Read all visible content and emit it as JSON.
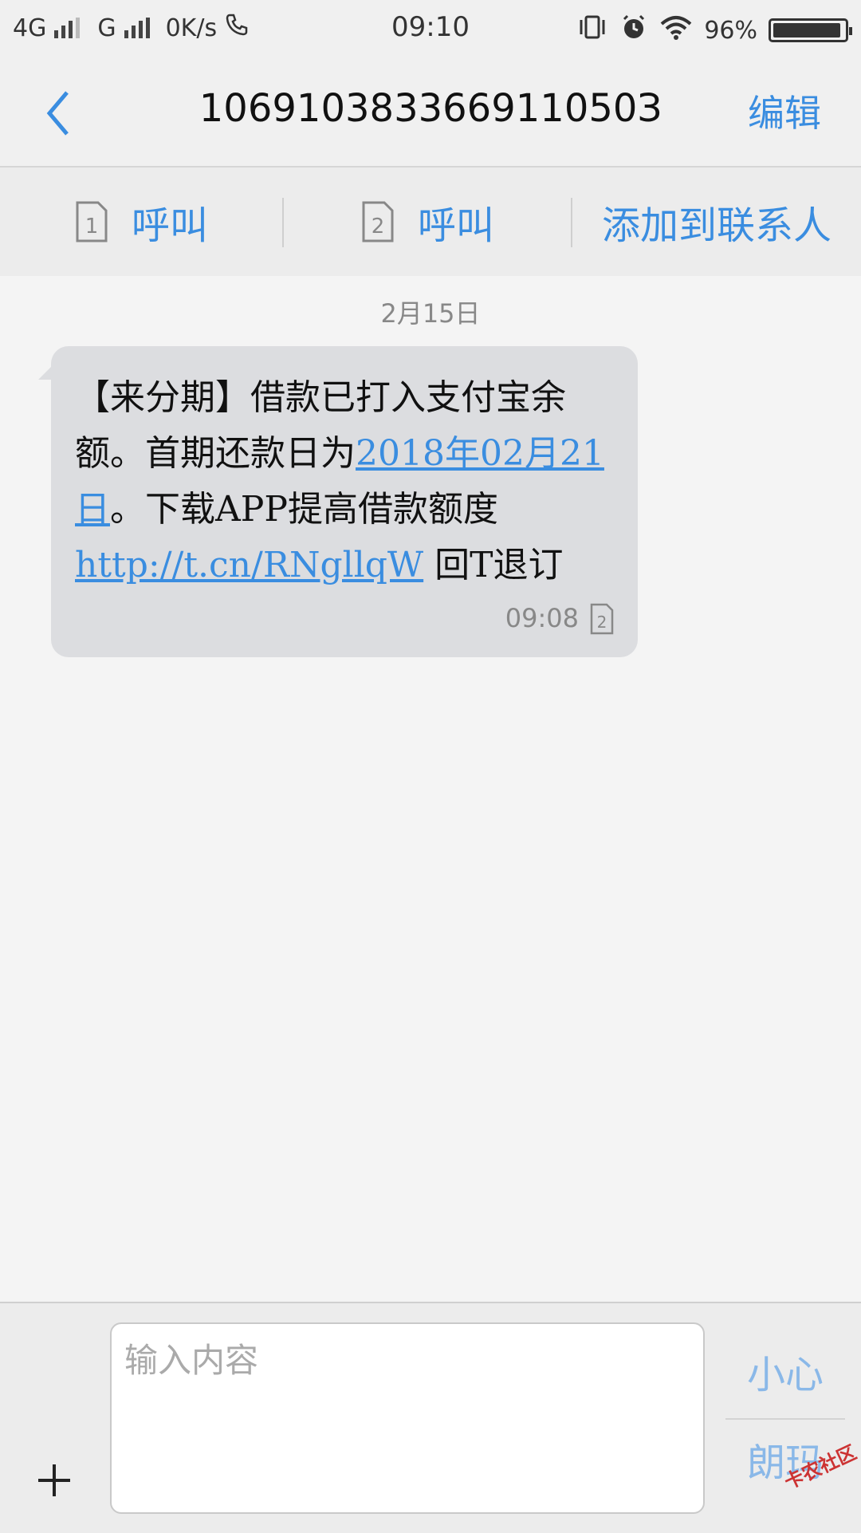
{
  "status_bar": {
    "network1": "4G",
    "network2": "G",
    "speed": "0K/s",
    "time": "09:10",
    "battery": "96%",
    "battery_level": 0.96
  },
  "header": {
    "title": "106910383366911050З",
    "edit_label": "编辑"
  },
  "actions": {
    "call1_label": "呼叫",
    "call2_label": "呼叫",
    "add_contact_label": "添加到联系人"
  },
  "conversation": {
    "date": "2月15日",
    "message": {
      "text_part1": "【来分期】借款已打入支付宝余额。首期还款日为",
      "date_link": "2018年02月21日",
      "text_part2": "。下载APP提高借款额度",
      "url_link": "http://t.cn/RNgllqW",
      "text_part3": " 回T退订",
      "time": "09:08",
      "sim_slot": "2"
    }
  },
  "composer": {
    "placeholder": "输入内容",
    "send1_label": "小心",
    "send2_label": "朗玛"
  },
  "watermark": "卡农社区",
  "icons": {
    "back": "chevron-left-icon",
    "sim1": "sim-1-icon",
    "sim2": "sim-2-icon",
    "plus": "plus-icon"
  },
  "colors": {
    "accent": "#3a8de0",
    "bubble": "#dcdde0"
  }
}
